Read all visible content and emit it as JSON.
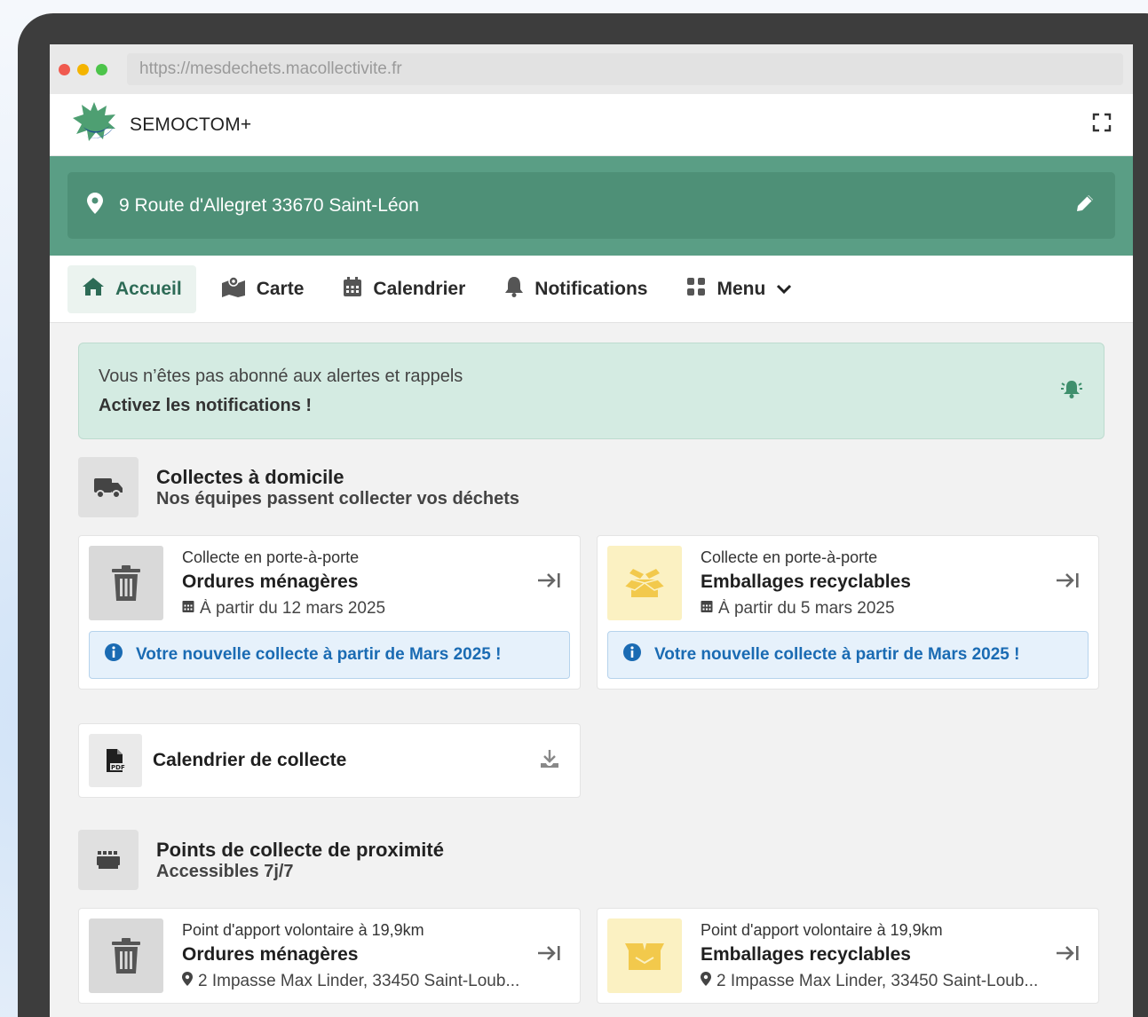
{
  "browser": {
    "url": "https://mesdechets.macollectivite.fr"
  },
  "app": {
    "brand_name": "SEMOCTOM+"
  },
  "address": {
    "text": "9 Route d'Allegret 33670 Saint-Léon"
  },
  "nav": {
    "items": [
      {
        "label": "Accueil",
        "icon": "home-icon",
        "active": true
      },
      {
        "label": "Carte",
        "icon": "map-icon"
      },
      {
        "label": "Calendrier",
        "icon": "calendar-icon"
      },
      {
        "label": "Notifications",
        "icon": "bell-icon"
      },
      {
        "label": "Menu",
        "icon": "grid-icon"
      }
    ]
  },
  "alert": {
    "line1": "Vous n’êtes pas abonné aux alertes et rappels",
    "line2": "Activez les notifications !"
  },
  "home_collection": {
    "title": "Collectes à domicile",
    "subtitle": "Nos équipes passent collecter vos déchets",
    "cards": [
      {
        "kind": "Collecte en porte-à-porte",
        "title": "Ordures ménagères",
        "date": "À partir du 12 mars 2025",
        "info": "Votre nouvelle collecte à partir de Mars 2025 !",
        "icon": "trash-icon"
      },
      {
        "kind": "Collecte en porte-à-porte",
        "title": "Emballages recyclables",
        "date": "À partir du 5 mars 2025",
        "info": "Votre nouvelle collecte à partir de Mars 2025 !",
        "icon": "open-box-icon"
      }
    ]
  },
  "calendar_pdf": {
    "label": "Calendrier de collecte"
  },
  "proximity": {
    "title": "Points de collecte de proximité",
    "subtitle": "Accessibles 7j/7",
    "cards": [
      {
        "kind": "Point d'apport volontaire à 19,9km",
        "title": "Ordures ménagères",
        "address": "2 Impasse Max Linder, 33450 Saint-Loub...",
        "icon": "trash-icon"
      },
      {
        "kind": "Point d'apport volontaire à 19,9km",
        "title": "Emballages recyclables",
        "address": "2 Impasse Max Linder, 33450 Saint-Loub...",
        "icon": "box-icon"
      }
    ]
  },
  "colors": {
    "brand_green": "#5a9e85",
    "recycle_yellow": "#f2c94c",
    "info_blue": "#1a6bb3"
  }
}
